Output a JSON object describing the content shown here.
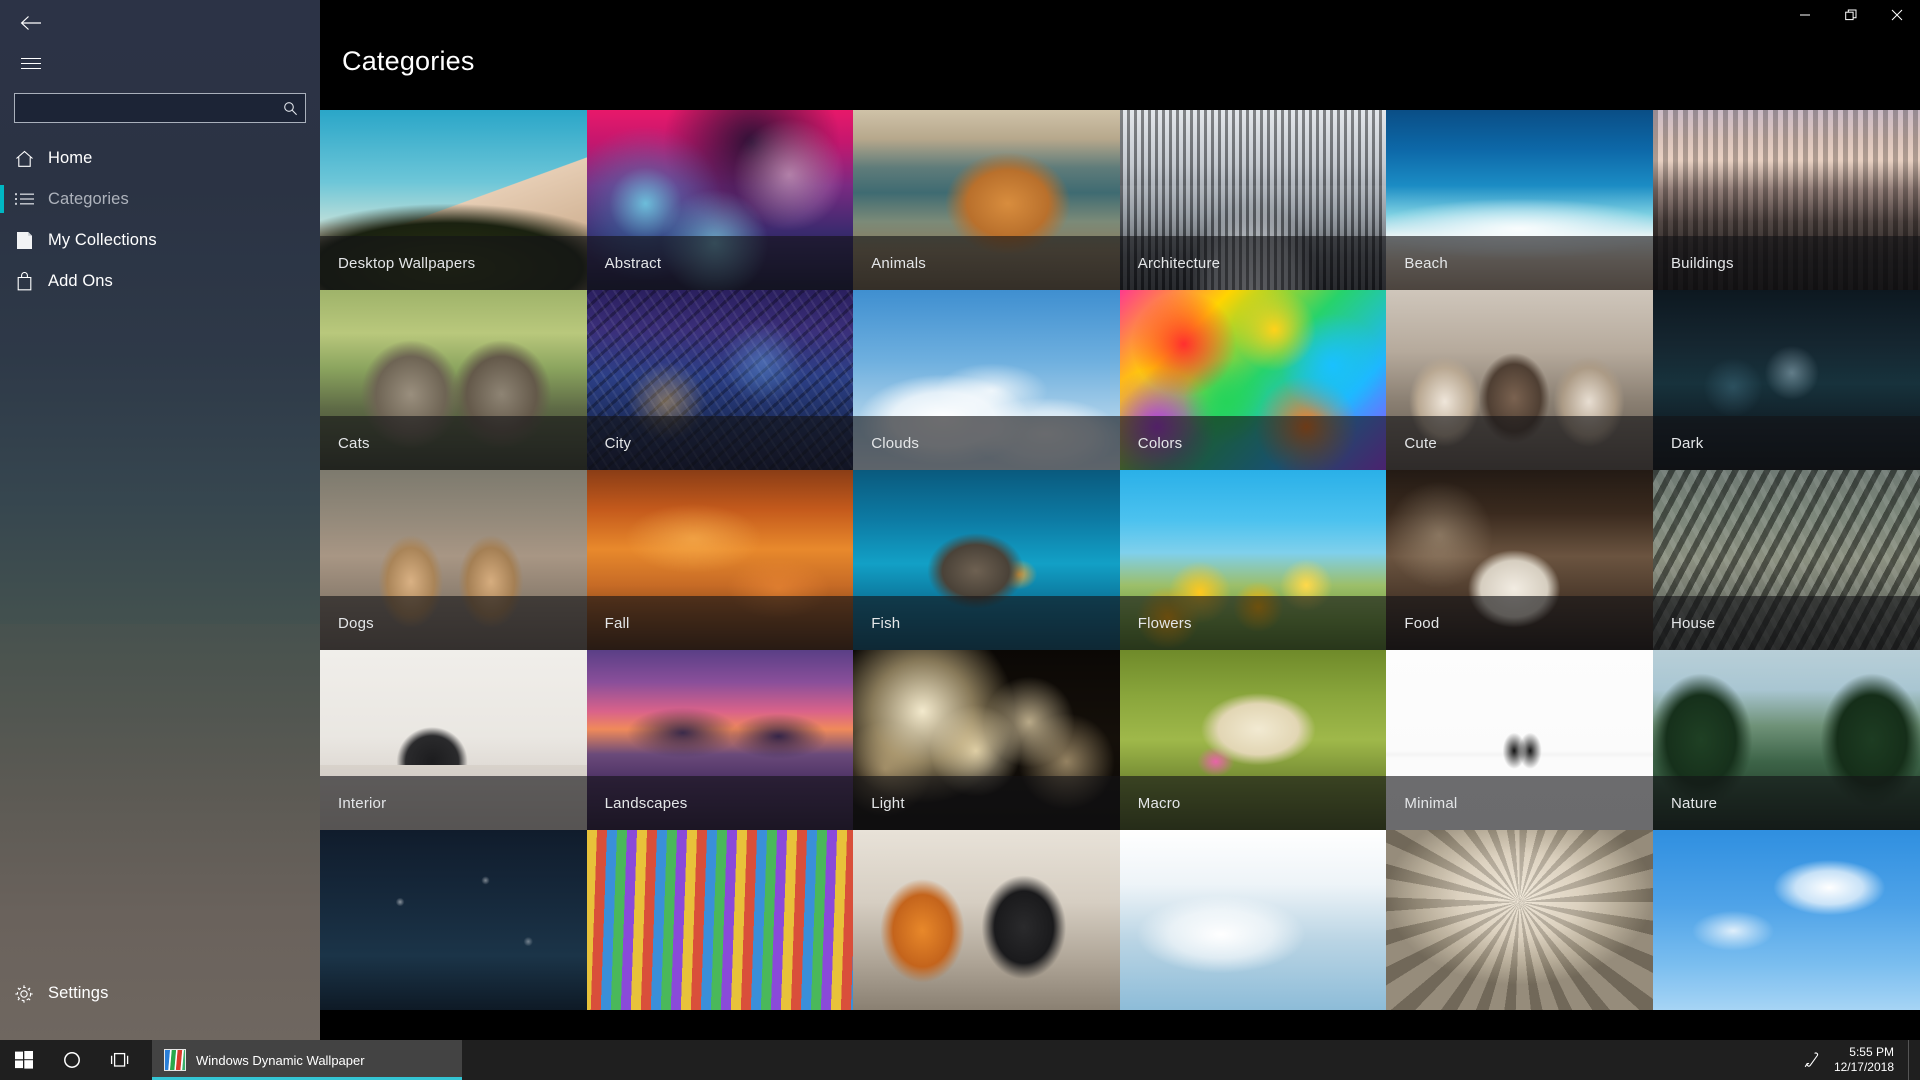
{
  "window": {
    "app_name": "Windows Dynamic Wallpaper",
    "page_title": "Categories",
    "controls": {
      "minimize": "Minimize",
      "restore": "Restore",
      "close": "Close"
    }
  },
  "sidebar": {
    "back_label": "Back",
    "menu_label": "Menu",
    "search": {
      "value": "",
      "placeholder": "",
      "icon": "search-icon"
    },
    "items": [
      {
        "label": "Home",
        "icon": "home-icon",
        "selected": false
      },
      {
        "label": "Categories",
        "icon": "list-icon",
        "selected": true
      },
      {
        "label": "My Collections",
        "icon": "collections-icon",
        "selected": false
      },
      {
        "label": "Add Ons",
        "icon": "bag-icon",
        "selected": false
      }
    ],
    "footer": {
      "label": "Settings",
      "icon": "gear-icon"
    },
    "accent_color": "#00b7c3"
  },
  "grid": {
    "columns": 6,
    "tiles": [
      {
        "label": "Desktop Wallpapers",
        "art": "art-dune"
      },
      {
        "label": "Abstract",
        "art": "art-abstract"
      },
      {
        "label": "Animals",
        "art": "art-animals"
      },
      {
        "label": "Architecture",
        "art": "art-architecture"
      },
      {
        "label": "Beach",
        "art": "art-beach"
      },
      {
        "label": "Buildings",
        "art": "art-buildings"
      },
      {
        "label": "Cats",
        "art": "art-cats"
      },
      {
        "label": "City",
        "art": "art-city"
      },
      {
        "label": "Clouds",
        "art": "art-clouds"
      },
      {
        "label": "Colors",
        "art": "art-colors"
      },
      {
        "label": "Cute",
        "art": "art-cute"
      },
      {
        "label": "Dark",
        "art": "art-dark"
      },
      {
        "label": "Dogs",
        "art": "art-dogs"
      },
      {
        "label": "Fall",
        "art": "art-fall"
      },
      {
        "label": "Fish",
        "art": "art-fish"
      },
      {
        "label": "Flowers",
        "art": "art-flowers"
      },
      {
        "label": "Food",
        "art": "art-food"
      },
      {
        "label": "House",
        "art": "art-house"
      },
      {
        "label": "Interior",
        "art": "art-interior"
      },
      {
        "label": "Landscapes",
        "art": "art-landscapes"
      },
      {
        "label": "Light",
        "art": "art-light"
      },
      {
        "label": "Macro",
        "art": "art-macro"
      },
      {
        "label": "Minimal",
        "art": "art-minimal"
      },
      {
        "label": "Nature",
        "art": "art-nature"
      },
      {
        "label": "",
        "art": "art-night"
      },
      {
        "label": "",
        "art": "art-paint"
      },
      {
        "label": "",
        "art": "art-people"
      },
      {
        "label": "",
        "art": "art-sky1"
      },
      {
        "label": "",
        "art": "art-vault"
      },
      {
        "label": "",
        "art": "art-blue"
      }
    ]
  },
  "taskbar": {
    "start_label": "Start",
    "cortana_label": "Cortana",
    "taskview_label": "Task View",
    "app": {
      "title": "Windows Dynamic Wallpaper",
      "active": true,
      "indicator_color": "#34c5d4"
    },
    "tray": {
      "pen_icon": "pen-icon"
    },
    "clock": {
      "time": "5:55 PM",
      "date": "12/17/2018"
    },
    "show_desktop_label": "Show desktop"
  }
}
